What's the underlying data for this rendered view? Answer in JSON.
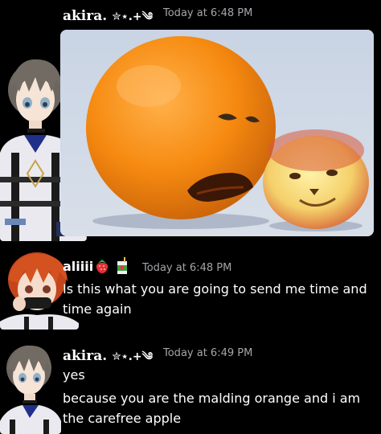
{
  "messages": [
    {
      "author": "akira.",
      "author_decoration": "✮⋆.+༄",
      "timestamp": "Today at 6:48 PM",
      "attachment": {
        "type": "image",
        "subject": "orange-and-apple-with-faces"
      }
    },
    {
      "author": "aliiii",
      "author_badges": [
        "strawberry-icon",
        "juice-box-icon"
      ],
      "timestamp": "Today at 6:48 PM",
      "lines": [
        "Is this what you are going to send me time and",
        "time again"
      ]
    },
    {
      "author": "akira.",
      "author_decoration": "✮⋆.+༄",
      "timestamp": "Today at 6:49 PM",
      "lines": [
        "yes",
        "because you are the malding orange and i am",
        "the carefree apple"
      ]
    }
  ]
}
